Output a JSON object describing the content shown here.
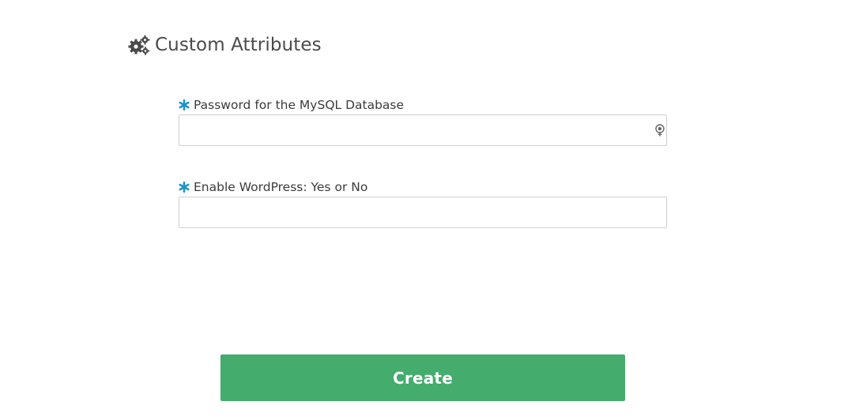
{
  "section": {
    "title": "Custom Attributes",
    "icon": "gears-icon"
  },
  "fields": [
    {
      "label": "Password for the MySQL Database",
      "required_icon": "asterisk-icon",
      "value": "",
      "type": "password",
      "trailing_icon": "key-icon"
    },
    {
      "label": "Enable WordPress: Yes or No",
      "required_icon": "asterisk-icon",
      "value": "",
      "type": "text"
    }
  ],
  "actions": {
    "create_label": "Create"
  },
  "colors": {
    "required_marker": "#1c93c7",
    "primary_button": "#44ac6c",
    "title_text": "#4a4a4a",
    "input_border": "#cfcfcf"
  }
}
